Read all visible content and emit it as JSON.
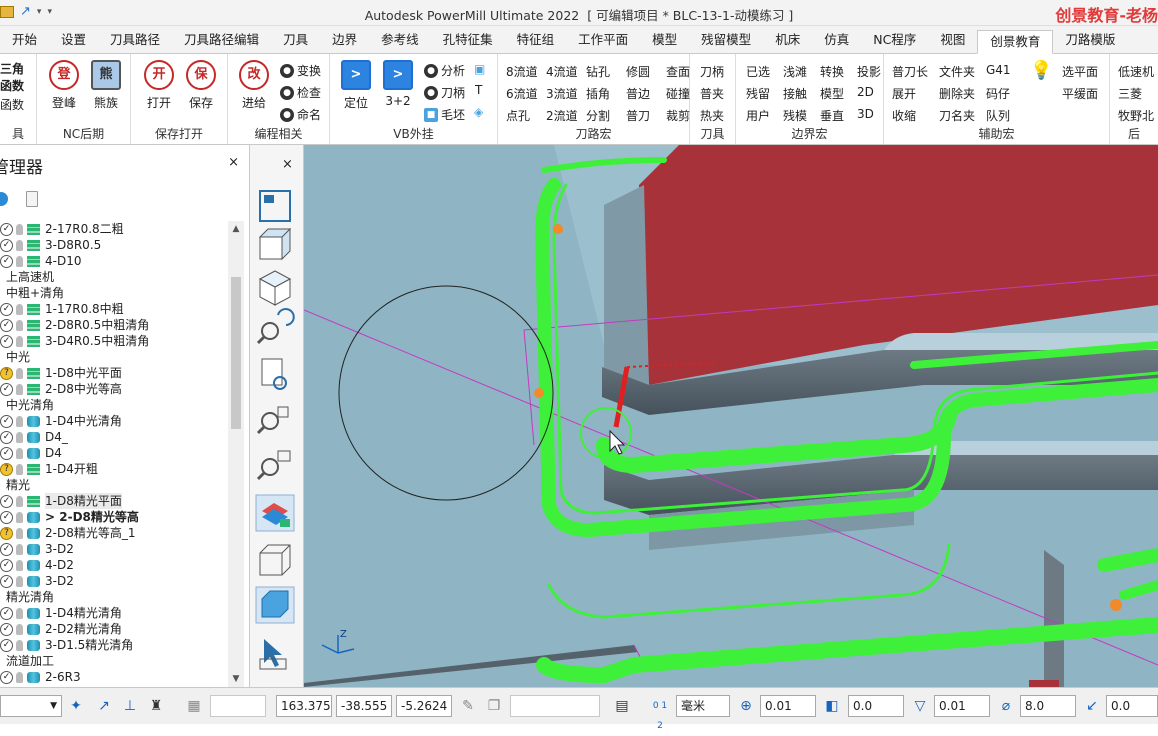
{
  "window": {
    "app_title": "Autodesk PowerMill Ultimate 2022",
    "project": "[ 可编辑项目 * BLC-13-1-动模练习 ]",
    "brand_watermark": "创景教育-老杨"
  },
  "tabs": [
    "开始",
    "设置",
    "刀具路径",
    "刀具路径编辑",
    "刀具",
    "边界",
    "参考线",
    "孔特征集",
    "特征组",
    "工作平面",
    "模型",
    "残留模型",
    "机床",
    "仿真",
    "NC程序",
    "视图",
    "创景教育",
    "刀路模版"
  ],
  "active_tab": "创景教育",
  "ribbon": {
    "partial_group": {
      "items": [
        "三角",
        "函数",
        "函数"
      ],
      "label": "具"
    },
    "nc": {
      "buttons": [
        {
          "icon": "登",
          "label": "登峰"
        },
        {
          "icon": "熊",
          "label": "熊族"
        }
      ],
      "label": "NC后期"
    },
    "save": {
      "buttons": [
        {
          "icon": "开",
          "label": "打开"
        },
        {
          "icon": "保",
          "label": "保存"
        }
      ],
      "label": "保存打开"
    },
    "edit": {
      "big": {
        "icon": "改",
        "label": "进给"
      },
      "items": [
        "变换",
        "检查",
        "命名"
      ],
      "label": "编程相关"
    },
    "vb": {
      "buttons": [
        "定位",
        "3+2"
      ],
      "items": [
        "分析",
        "刀柄",
        "毛坯"
      ],
      "label": "VB外挂"
    },
    "toolpath_macro": {
      "cols": [
        [
          "8流道",
          "6流道",
          "点孔"
        ],
        [
          "4流道",
          "3流道",
          "2流道"
        ],
        [
          "钻孔",
          "插角",
          "分割"
        ],
        [
          "修圆",
          "普边",
          "普刀"
        ],
        [
          "查面",
          "碰撞",
          "裁剪"
        ]
      ],
      "label": "刀路宏"
    },
    "tool": {
      "items": [
        "刀柄",
        "普夹",
        "热夹"
      ],
      "label": "刀具"
    },
    "boundary": {
      "cols": [
        [
          "已选",
          "残留",
          "用户"
        ],
        [
          "浅滩",
          "接触",
          "残模"
        ],
        [
          "转换",
          "模型",
          "垂直"
        ],
        [
          "投影",
          "2D",
          "3D"
        ]
      ],
      "label": "边界宏"
    },
    "aux": {
      "cols": [
        [
          "普刀长",
          "展开",
          "收缩"
        ],
        [
          "文件夹",
          "删除夹",
          "刀名夹"
        ],
        [
          "G41",
          "码仔",
          "队列"
        ]
      ],
      "extra": [
        "选平面",
        "平缓面"
      ],
      "label": "辅助宏"
    },
    "right": {
      "items": [
        "低速机",
        "三菱",
        "牧野北"
      ],
      "label": "后"
    }
  },
  "explorer": {
    "title": "管理器",
    "close": "×",
    "rows": [
      {
        "kind": "tp",
        "chk": "v",
        "icon": "layer",
        "label": "2-17R0.8二粗"
      },
      {
        "kind": "tp",
        "chk": "v",
        "icon": "layer",
        "label": "3-D8R0.5"
      },
      {
        "kind": "tp",
        "chk": "v",
        "icon": "layer",
        "label": "4-D10"
      },
      {
        "kind": "folder",
        "label": "上高速机"
      },
      {
        "kind": "folder",
        "label": "中粗+清角"
      },
      {
        "kind": "tp",
        "chk": "v",
        "icon": "layer",
        "label": "1-17R0.8中粗"
      },
      {
        "kind": "tp",
        "chk": "v",
        "icon": "layer",
        "label": "2-D8R0.5中粗清角"
      },
      {
        "kind": "tp",
        "chk": "v",
        "icon": "layer",
        "label": "3-D4R0.5中粗清角"
      },
      {
        "kind": "folder",
        "label": "中光"
      },
      {
        "kind": "tp",
        "chk": "q",
        "icon": "layer",
        "label": "1-D8中光平面"
      },
      {
        "kind": "tp",
        "chk": "v",
        "icon": "layer",
        "label": "2-D8中光等高"
      },
      {
        "kind": "folder",
        "label": "中光清角"
      },
      {
        "kind": "tp",
        "chk": "v",
        "icon": "cyl",
        "label": "1-D4中光清角"
      },
      {
        "kind": "tp",
        "chk": "v",
        "icon": "cyl",
        "label": "D4_"
      },
      {
        "kind": "tp",
        "chk": "v",
        "icon": "cyl",
        "label": "D4"
      },
      {
        "kind": "tp",
        "chk": "q",
        "icon": "layer",
        "label": "1-D4开粗"
      },
      {
        "kind": "folder",
        "label": "精光"
      },
      {
        "kind": "tp",
        "chk": "v",
        "icon": "layer",
        "label": "1-D8精光平面",
        "sel": true
      },
      {
        "kind": "tp",
        "chk": "v",
        "icon": "cyl",
        "label": "> 2-D8精光等高",
        "bold": true
      },
      {
        "kind": "tp",
        "chk": "q",
        "icon": "cyl",
        "label": "2-D8精光等高_1"
      },
      {
        "kind": "tp",
        "chk": "v",
        "icon": "cyl",
        "label": "3-D2"
      },
      {
        "kind": "tp",
        "chk": "v",
        "icon": "cyl",
        "label": "4-D2"
      },
      {
        "kind": "tp",
        "chk": "v",
        "icon": "cyl",
        "label": "3-D2"
      },
      {
        "kind": "folder",
        "label": "精光清角"
      },
      {
        "kind": "tp",
        "chk": "v",
        "icon": "cyl",
        "label": "1-D4精光清角"
      },
      {
        "kind": "tp",
        "chk": "v",
        "icon": "cyl",
        "label": "2-D2精光清角"
      },
      {
        "kind": "tp",
        "chk": "v",
        "icon": "cyl",
        "label": "3-D1.5精光清角"
      },
      {
        "kind": "folder",
        "label": "流道加工"
      },
      {
        "kind": "tp",
        "chk": "v",
        "icon": "cyl",
        "label": "2-6R3"
      }
    ]
  },
  "sidebar": {
    "close": "×"
  },
  "viewport": {
    "axis_label": "Z"
  },
  "status": {
    "x": "163.375",
    "y": "-38.555",
    "z": "-5.2624",
    "units": "毫米",
    "tolerance": "0.01",
    "offset": "0.0",
    "tool_tolerance": "0.01",
    "diameter": "8.0",
    "step": "0.0"
  },
  "colors": {
    "toolpath_green": "#3ff03a",
    "model_face": "#8fb5c4",
    "wall_dark": "#55626b",
    "red_block": "#a8323a",
    "boundary_magenta": "#c23ac2",
    "brand_red": "#e23a3a"
  }
}
